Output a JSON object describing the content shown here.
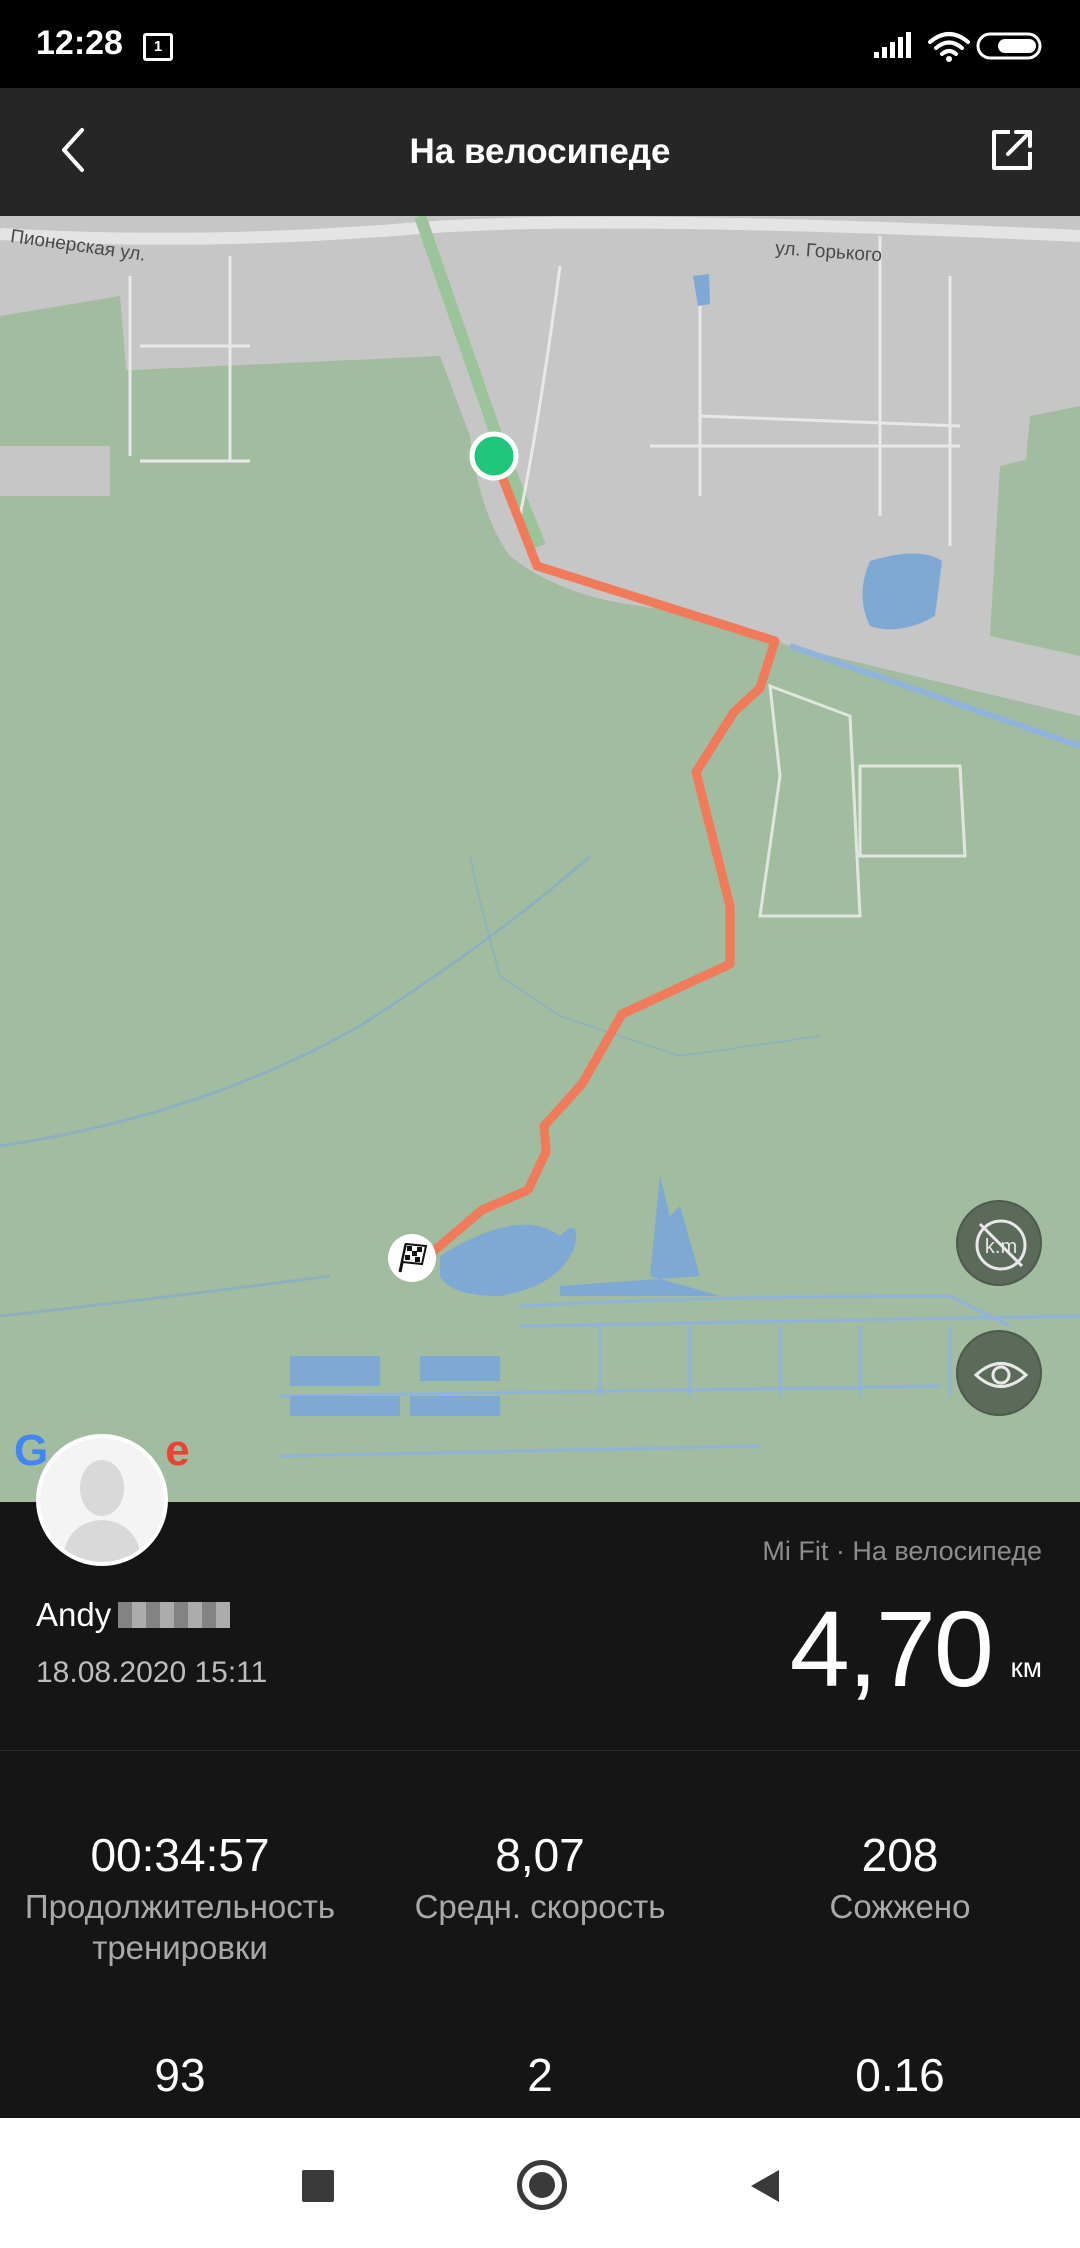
{
  "status_bar": {
    "time": "12:28",
    "notification_count": "1",
    "icons": [
      "signal-icon",
      "wifi-icon",
      "battery-icon"
    ]
  },
  "header": {
    "title": "На велосипеде",
    "back_icon": "chevron-left-icon",
    "share_icon": "share-icon"
  },
  "map": {
    "labels": {
      "street_1": "Пионерская ул.",
      "street_2": "ул. Горького"
    },
    "start_marker_color": "#20c77a",
    "route_color": "#f07a5a",
    "finish_icon": "checkered-flag-icon",
    "units_toggle_label": "k.m",
    "eye_icon": "eye-icon",
    "attribution": "Google"
  },
  "workout": {
    "user_name": "Andy",
    "date": "18.08.2020 15:11",
    "source": "Mi Fit · На велосипеде",
    "distance": "4,70",
    "distance_unit": "км"
  },
  "stats": [
    {
      "value": "00:34:57",
      "label": "Продолжительность тренировки"
    },
    {
      "value": "8,07",
      "label": "Средн. скорость"
    },
    {
      "value": "208",
      "label": "Сожжено"
    },
    {
      "value": "93",
      "label": ""
    },
    {
      "value": "2",
      "label": ""
    },
    {
      "value": "0.16",
      "label": ""
    }
  ],
  "nav_bar": {
    "icons": [
      "recent-apps-icon",
      "home-icon",
      "back-icon"
    ]
  }
}
